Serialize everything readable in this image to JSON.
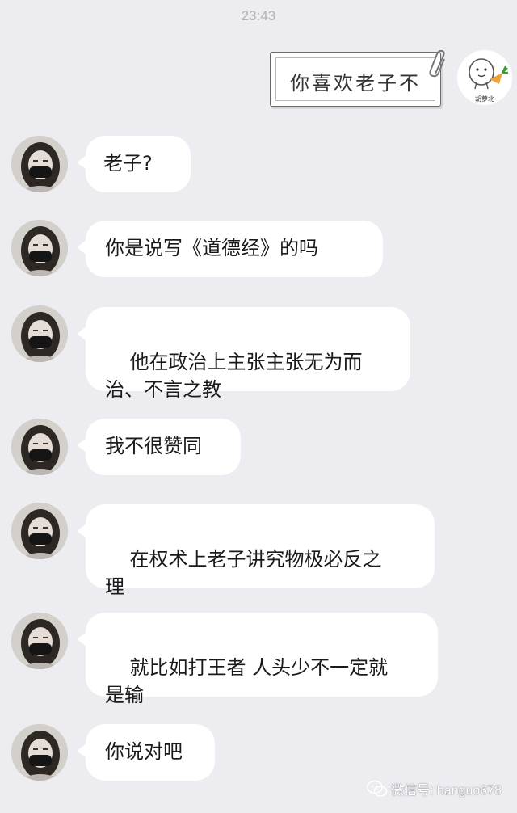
{
  "chat": {
    "timestamp": "23:43",
    "sent_message": "你喜欢老子不",
    "sent_avatar_caption": "胡萝北",
    "received_messages": [
      "老子?",
      "你是说写《道德经》的吗",
      "他在政治上主张主张无为而\n治、不言之教",
      "我不很赞同",
      "在权术上老子讲究物极必反之\n理",
      "就比如打王者 人头少不一定就\n是输",
      "你说对吧"
    ]
  },
  "watermark": {
    "text": "微信号: hanguo678"
  },
  "colors": {
    "background": "#ececf1",
    "bubble": "#ffffff",
    "text": "#1a1a1a",
    "timestamp": "#b2b2b6"
  }
}
